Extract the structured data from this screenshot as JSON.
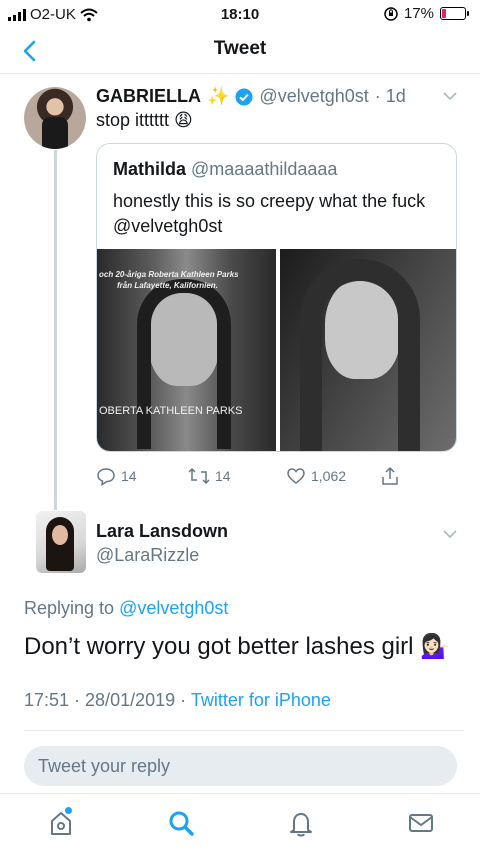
{
  "status_bar": {
    "carrier": "O2-UK",
    "time": "18:10",
    "battery_percent": "17%",
    "battery_level": 0.17
  },
  "nav": {
    "title": "Tweet"
  },
  "parent_tweet": {
    "name": "GABRIELLA",
    "name_emoji": "✨",
    "handle": "@velvetgh0st",
    "age": "· 1d",
    "text": "stop itttttt",
    "text_emoji": "😩",
    "quoted": {
      "name": "Mathilda",
      "handle": "@maaaathildaaaa",
      "text": "honestly this is so creepy what the fuck @velvetgh0st",
      "image_left": {
        "caption_top_1": "och 20-åriga Roberta Kathleen Parks",
        "caption_top_2": "från Lafayette, Kalifornien.",
        "caption_bottom": "OBERTA KATHLEEN PARKS"
      }
    },
    "actions": {
      "replies": "14",
      "retweets": "14",
      "likes": "1,062"
    }
  },
  "main_tweet": {
    "name": "Lara Lansdown",
    "handle": "@LaraRizzle",
    "replying_prefix": "Replying to",
    "replying_to": "@velvetgh0st",
    "text": "Don’t worry you got better lashes girl",
    "text_emoji": "💁🏻‍♀️",
    "timestamp": "17:51 · 28/01/2019 ·",
    "source": "Twitter for iPhone"
  },
  "compose": {
    "placeholder": "Tweet your reply"
  },
  "colors": {
    "accent": "#1da1f2",
    "muted": "#657786",
    "border": "#e6ecf0"
  },
  "tabbar": {
    "icons": [
      "home-icon",
      "search-icon",
      "notifications-icon",
      "messages-icon"
    ]
  }
}
